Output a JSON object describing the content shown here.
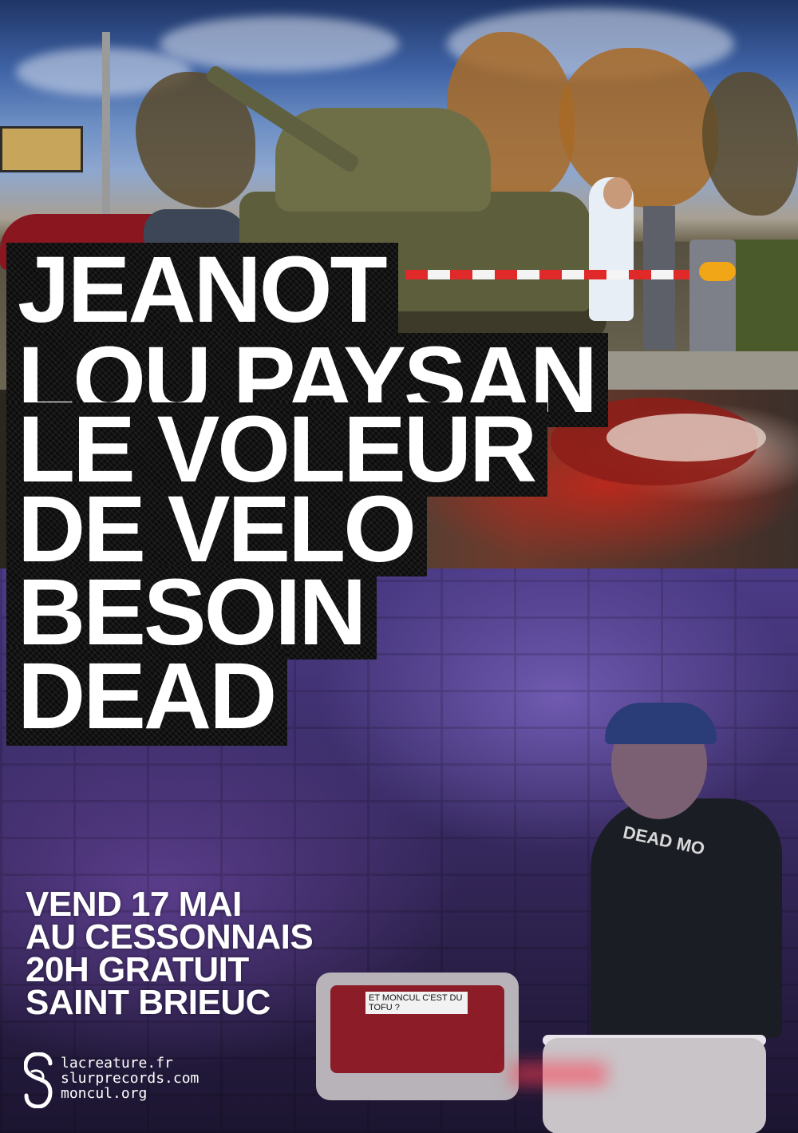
{
  "bands": [
    "JEANOT",
    "LOU PAYSAN",
    "LE VOLEUR",
    "DE VELO",
    "BESOIN",
    "DEAD"
  ],
  "event": {
    "date": "VEND 17 MAI",
    "venue": "AU CESSONNAIS",
    "time_price": "20H GRATUIT",
    "city": "SAINT BRIEUC"
  },
  "amp_sticker": "ET MONCUL C'EST DU TOFU ?",
  "shirt_text": "DEAD MO",
  "links": [
    "lacreature.fr",
    "slurprecords.com",
    "moncul.org"
  ],
  "colors": {
    "text": "#ffffff",
    "label_bg": "#0c0c0c",
    "barrier_orange": "#f0a616",
    "barrier_red": "#e02a2a"
  },
  "logo_icon": "slur-s-logo-icon"
}
